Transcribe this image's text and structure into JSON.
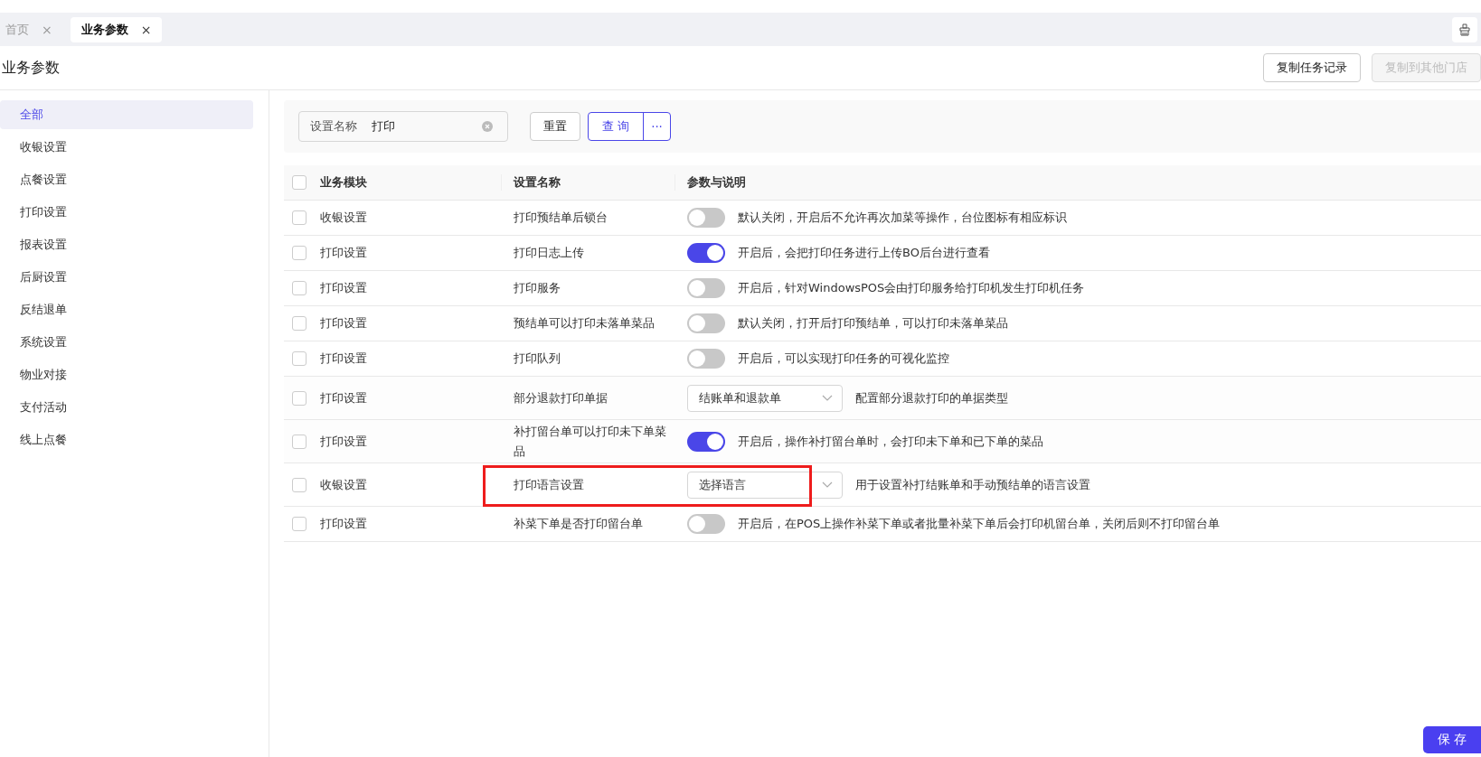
{
  "tabs": [
    {
      "label": "首页",
      "selected": false,
      "close": "×"
    },
    {
      "label": "业务参数",
      "selected": true,
      "close": "×"
    }
  ],
  "page_title": "业务参数",
  "header_buttons": [
    {
      "label": "复制任务记录",
      "disabled": false
    },
    {
      "label": "复制到其他门店",
      "disabled": true
    }
  ],
  "sidebar": {
    "items": [
      {
        "label": "全部",
        "selected": true
      },
      {
        "label": "收银设置",
        "selected": false
      },
      {
        "label": "点餐设置",
        "selected": false
      },
      {
        "label": "打印设置",
        "selected": false
      },
      {
        "label": "报表设置",
        "selected": false
      },
      {
        "label": "后厨设置",
        "selected": false
      },
      {
        "label": "反结退单",
        "selected": false
      },
      {
        "label": "系统设置",
        "selected": false
      },
      {
        "label": "物业对接",
        "selected": false
      },
      {
        "label": "支付活动",
        "selected": false
      },
      {
        "label": "线上点餐",
        "selected": false
      }
    ]
  },
  "filter": {
    "label": "设置名称",
    "value": "打印",
    "reset": "重置",
    "query": "查 询",
    "more": "···"
  },
  "table": {
    "columns": [
      "业务模块",
      "设置名称",
      "参数与说明"
    ],
    "all_checked": false,
    "rows": [
      {
        "module": "收银设置",
        "name": "打印预结单后锁台",
        "kind": "toggle",
        "on": false,
        "description": "默认关闭，开启后不允许再次加菜等操作，台位图标有相应标识",
        "checked": false,
        "highlighted": false
      },
      {
        "module": "打印设置",
        "name": "打印日志上传",
        "kind": "toggle",
        "on": true,
        "description": "开启后，会把打印任务进行上传BO后台进行查看",
        "checked": false,
        "highlighted": false
      },
      {
        "module": "打印设置",
        "name": "打印服务",
        "kind": "toggle",
        "on": false,
        "description": "开启后，针对WindowsPOS会由打印服务给打印机发生打印机任务",
        "checked": false,
        "highlighted": false
      },
      {
        "module": "打印设置",
        "name": "预结单可以打印未落单菜品",
        "kind": "toggle",
        "on": false,
        "description": "默认关闭，打开后打印预结单，可以打印未落单菜品",
        "checked": false,
        "highlighted": false
      },
      {
        "module": "打印设置",
        "name": "打印队列",
        "kind": "toggle",
        "on": false,
        "description": "开启后，可以实现打印任务的可视化监控",
        "checked": false,
        "highlighted": false
      },
      {
        "module": "打印设置",
        "name": "部分退款打印单据",
        "kind": "select",
        "value": "结账单和退款单",
        "description": "配置部分退款打印的单据类型",
        "checked": false,
        "highlighted": false
      },
      {
        "module": "打印设置",
        "name": "补打留台单可以打印未下单菜品",
        "kind": "toggle",
        "on": true,
        "description": "开启后，操作补打留台单时，会打印未下单和已下单的菜品",
        "checked": false,
        "highlighted": false
      },
      {
        "module": "收银设置",
        "name": "打印语言设置",
        "kind": "select",
        "placeholder": "选择语言",
        "description": "用于设置补打结账单和手动预结单的语言设置",
        "checked": false,
        "highlighted": true
      },
      {
        "module": "打印设置",
        "name": "补菜下单是否打印留台单",
        "kind": "toggle",
        "on": false,
        "description": "开启后，在POS上操作补菜下单或者批量补菜下单后会打印机留台单，关闭后则不打印留台单",
        "checked": false,
        "highlighted": false
      }
    ]
  },
  "save": "保 存"
}
